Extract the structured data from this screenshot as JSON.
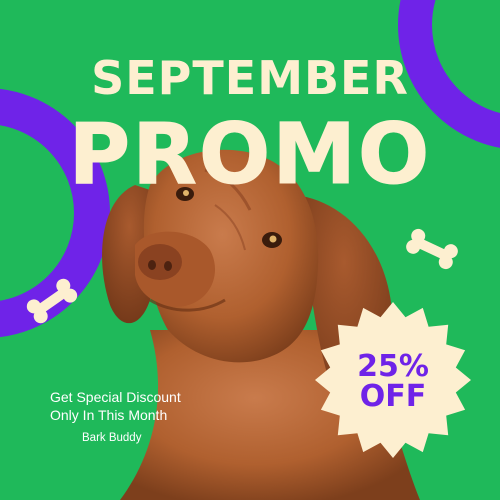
{
  "colors": {
    "background": "#1fb95a",
    "accent_purple": "#6f23e8",
    "cream": "#fdefd0",
    "dog_fur": "#b8643a"
  },
  "icons": [
    "bone-icon",
    "bone-icon",
    "starburst-badge"
  ],
  "headline": "SEPTEMBER",
  "promo_word": "PROMO",
  "badge": {
    "line1": "25%",
    "line2": "OFF"
  },
  "description": {
    "line1": "Get Special Discount",
    "line2": "Only In This Month"
  },
  "brand": "Bark Buddy"
}
